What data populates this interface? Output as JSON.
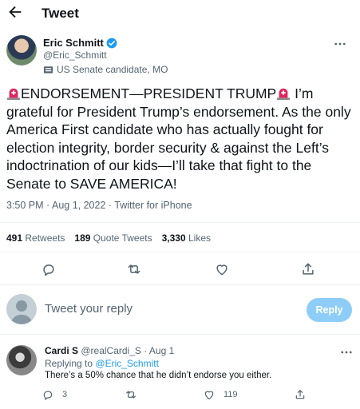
{
  "header": {
    "title": "Tweet"
  },
  "author": {
    "name": "Eric Schmitt",
    "handle": "@Eric_Schmitt",
    "label": "US Senate candidate, MO"
  },
  "tweet": {
    "part1": "ENDORSEMENT—PRESIDENT TRUMP",
    "part2": "I’m grateful for President Trump’s endorsement. As the only America First candidate who has actually fought for election integrity, border security & against the Left’s indoctrination of our kids—I’ll take that fight to the Senate to SAVE AMERICA!",
    "time": "3:50 PM",
    "date": "Aug 1, 2022",
    "source": "Twitter for iPhone"
  },
  "stats": {
    "retweets_count": "491",
    "retweets_label": "Retweets",
    "quotes_count": "189",
    "quotes_label": "Quote Tweets",
    "likes_count": "3,330",
    "likes_label": "Likes"
  },
  "composer": {
    "placeholder": "Tweet your reply",
    "button": "Reply"
  },
  "reply": {
    "name": "Cardi S",
    "handle": "@realCardi_S",
    "date": "Aug 1",
    "replying_prefix": "Replying to",
    "replying_to": "@Eric_Schmitt",
    "text": "There’s a 50% chance that he didn’t endorse you either.",
    "reply_count": "3",
    "like_count": "119"
  },
  "colors": {
    "accent": "#1d9bf0",
    "reply_button_disabled": "#8ecdf8",
    "siren": "#e0245e",
    "text": "#0f1419",
    "secondary": "#536471"
  },
  "icons": [
    "back-arrow-icon",
    "verified-badge-icon",
    "government-label-icon",
    "more-icon",
    "siren-emoji-icon",
    "reply-icon",
    "retweet-icon",
    "like-icon",
    "share-icon"
  ]
}
